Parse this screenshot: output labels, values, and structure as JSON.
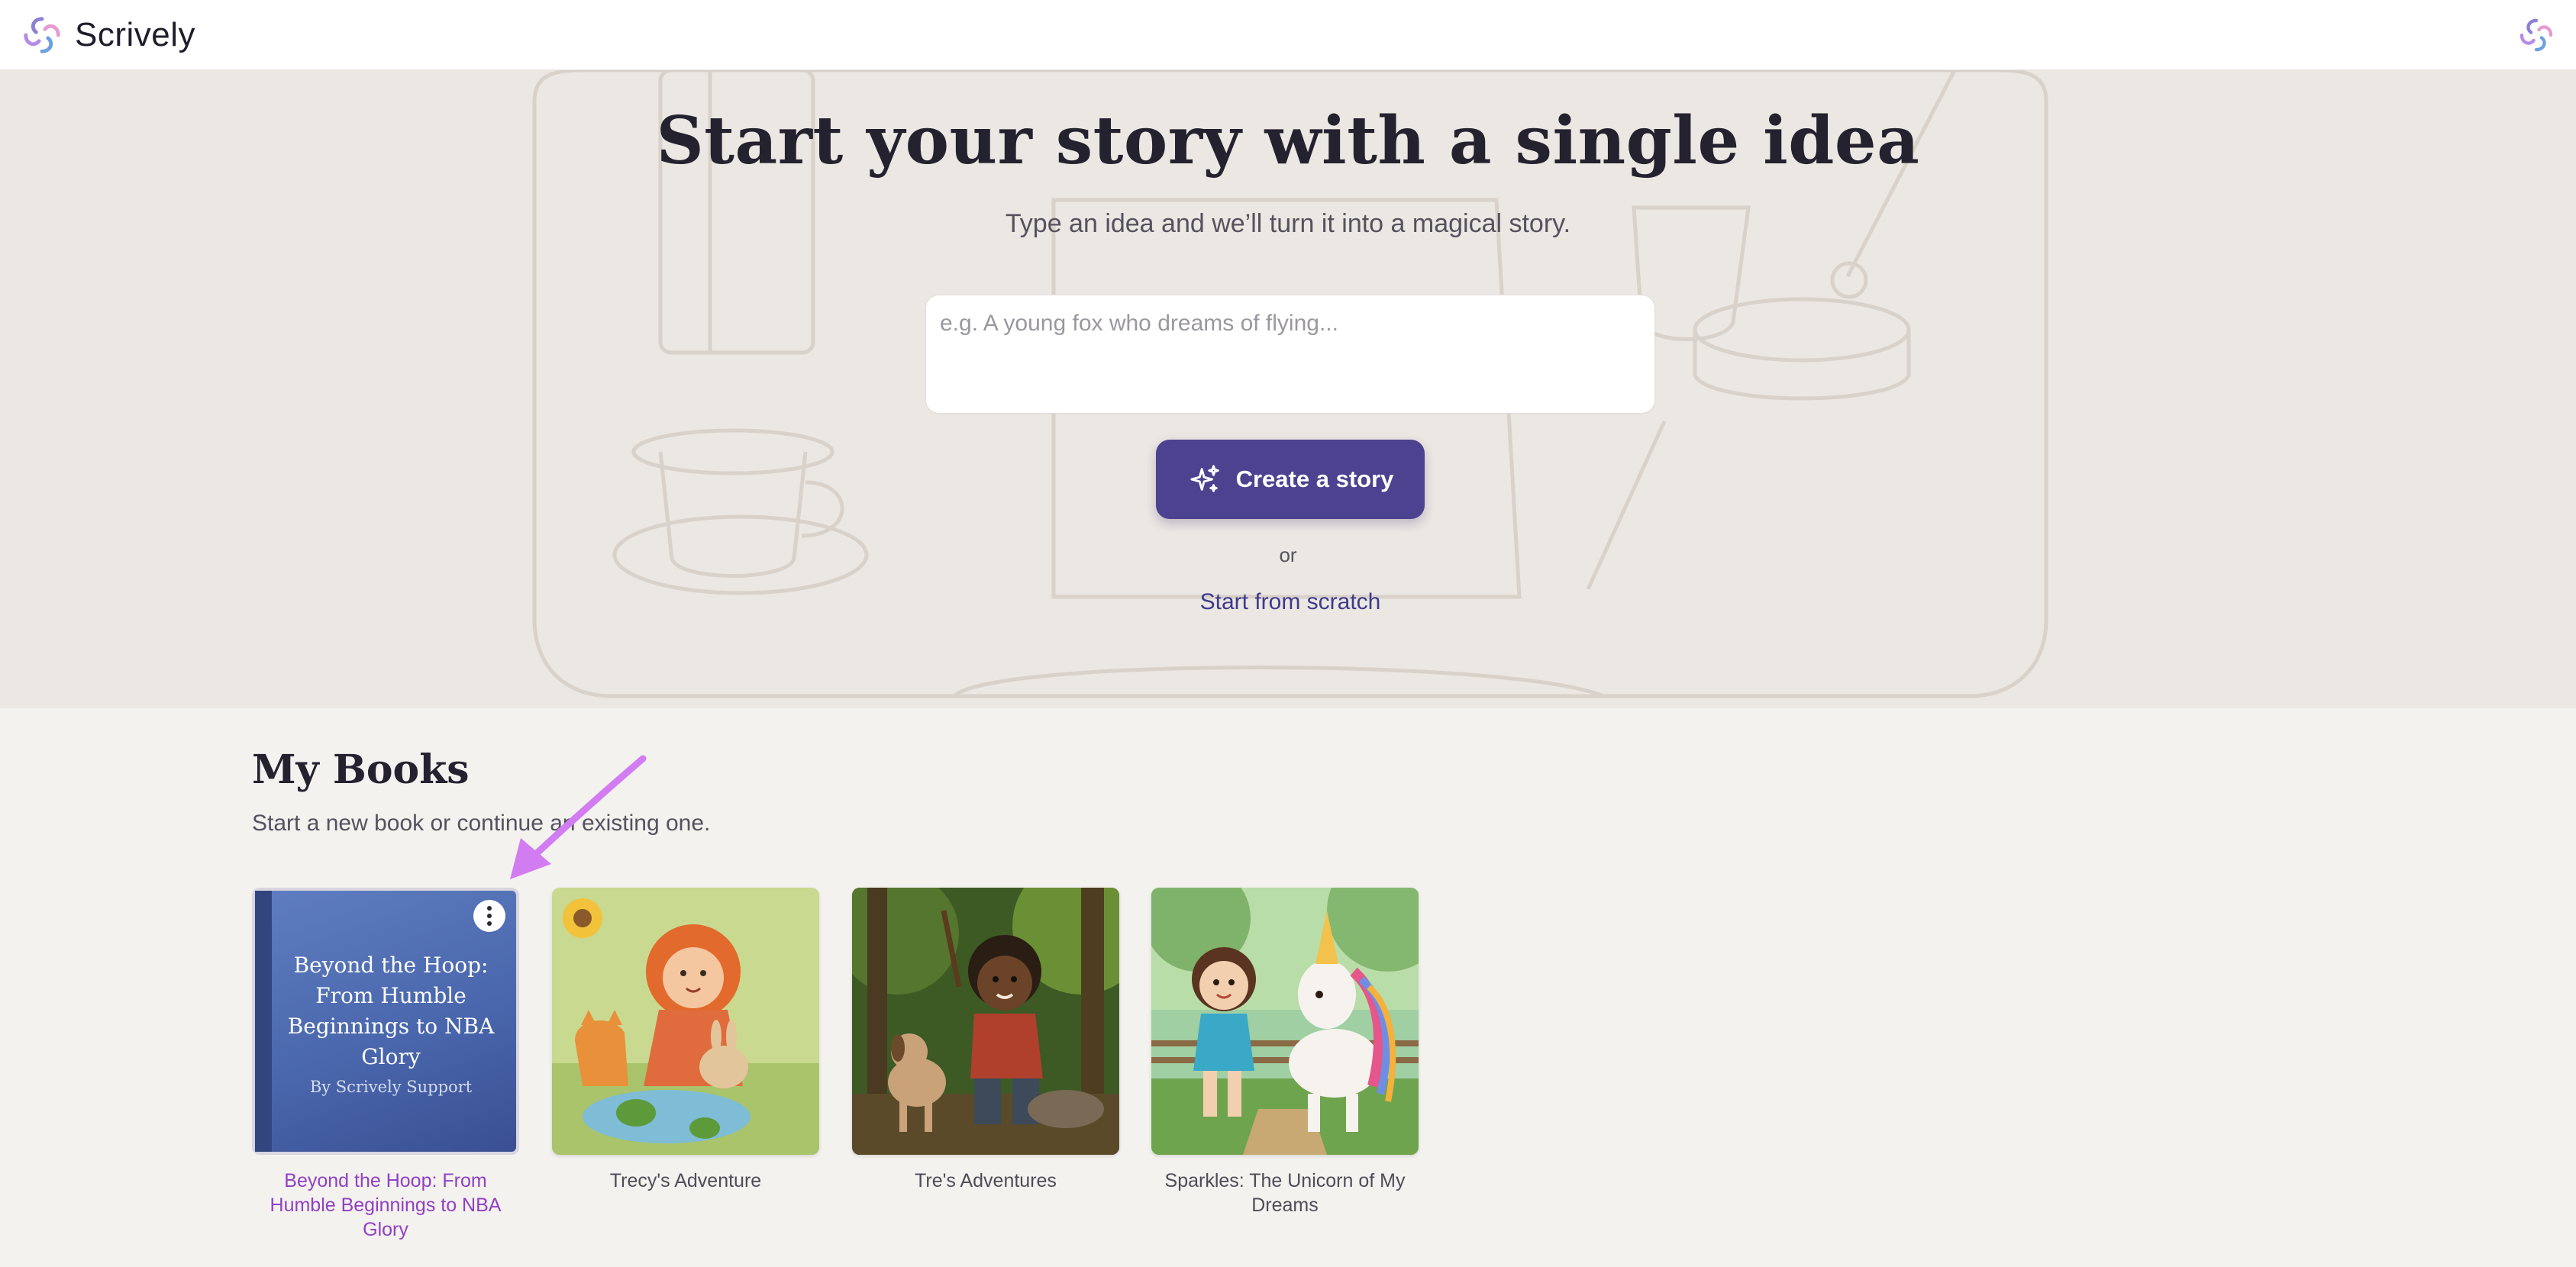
{
  "header": {
    "brand_name": "Scrively",
    "logo_icon": "swirl-logo-icon",
    "account_icon": "swirl-avatar-icon"
  },
  "hero": {
    "title": "Start your story with a single idea",
    "subtitle": "Type an idea and we’ll turn it into a magical story.",
    "idea_placeholder": "e.g. A young fox who dreams of flying...",
    "idea_value": "",
    "create_button_label": "Create a story",
    "create_button_icon": "sparkles-icon",
    "or_text": "or",
    "scratch_link_label": "Start from scratch"
  },
  "my_books": {
    "title": "My Books",
    "subtitle": "Start a new book or continue an existing one.",
    "books": [
      {
        "caption": "Beyond the Hoop: From Humble Beginnings to NBA Glory",
        "cover_title": "Beyond the Hoop: From Humble Beginnings to NBA Glory",
        "cover_author": "By Scrively Support",
        "cover_type": "generated-text-cover",
        "has_menu": true
      },
      {
        "caption": "Trecy's Adventure",
        "cover_type": "illustration-girl-cat-rabbit-frogs"
      },
      {
        "caption": "Tre's Adventures",
        "cover_type": "illustration-boy-dog-forest"
      },
      {
        "caption": "Sparkles: The Unicorn of My Dreams",
        "cover_type": "illustration-girl-unicorn"
      }
    ]
  },
  "colors": {
    "brand_purple": "#4c4290",
    "link_blue": "#3f3a8c",
    "active_caption": "#9140c4",
    "annotation_arrow": "#d27cf2",
    "cover_blue": "#4a67ad"
  }
}
